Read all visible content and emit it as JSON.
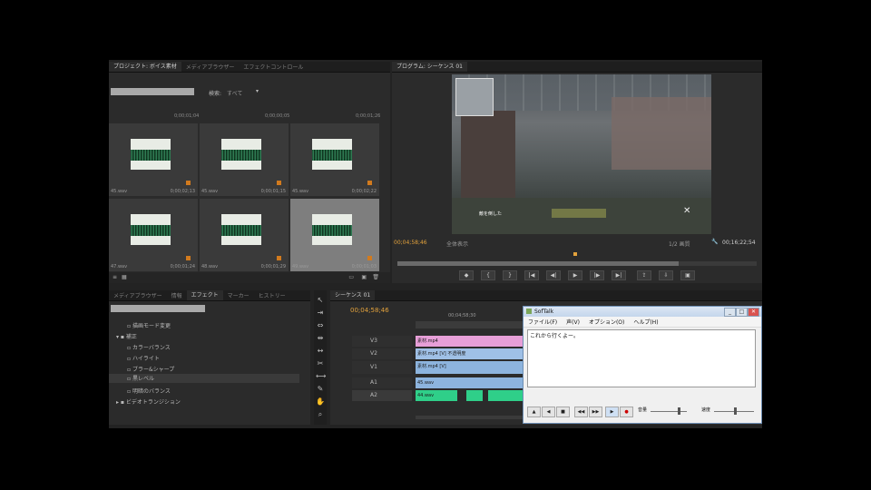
{
  "project": {
    "tabs": [
      "プロジェクト: ボイス素材",
      "メディアブラウザー",
      "エフェクトコントロール"
    ],
    "search_value": "",
    "in_label": "検索:",
    "in_value": "すべて",
    "thumbs": [
      {
        "name": "45.wav",
        "dur": "0;00;02;13"
      },
      {
        "name": "45.wav",
        "dur": "0;00;01;15"
      },
      {
        "name": "45.wav",
        "dur": "0;00;02;22"
      },
      {
        "name": "47.wav",
        "dur": "0;00;01;24"
      },
      {
        "name": "48.wav",
        "dur": "0;00;01;29"
      },
      {
        "name": "49.wav",
        "dur": "0;00;01;03"
      }
    ],
    "top_row_durs": [
      "0;00;01;04",
      "0;00;00;05",
      "0;00;01;26"
    ]
  },
  "monitor": {
    "tab": "プログラム: シーケンス 01",
    "timecode_left": "00;04;58;46",
    "fit": "全体表示",
    "quality": "1/2 画質",
    "timecode_right": "00;16;22;54",
    "hud_text": "敵を倒した"
  },
  "effects": {
    "tabs": [
      "メディアブラウザー",
      "情報",
      "エフェクト",
      "マーカー",
      "ヒストリー"
    ],
    "items": [
      "描画モード変更",
      "補正",
      "カラーバランス",
      "ハイライト",
      "ブラー&シャープ",
      "黒レベル",
      "明暗のバランス",
      "ビデオトランジション"
    ],
    "bin_label": "ビデオトランジション"
  },
  "timeline": {
    "tab": "シーケンス 01",
    "timecode": "00;04;58;46",
    "ruler_label": "00;04;58;30",
    "tracks": [
      "V3",
      "V2",
      "V1",
      "A1",
      "A2"
    ],
    "clip_labels": [
      "素材.mp4",
      "素材.mp4 [V] 不透明度",
      "素材.mp4 [V]",
      "45.wav",
      "44.wav"
    ]
  },
  "softalk": {
    "title": "SofTalk",
    "menus": [
      "ファイル(F)",
      "声(V)",
      "オプション(O)",
      "ヘルプ(H)"
    ],
    "text": "これから行くよー。",
    "volume_label": "音量",
    "speed_label": "速度"
  }
}
